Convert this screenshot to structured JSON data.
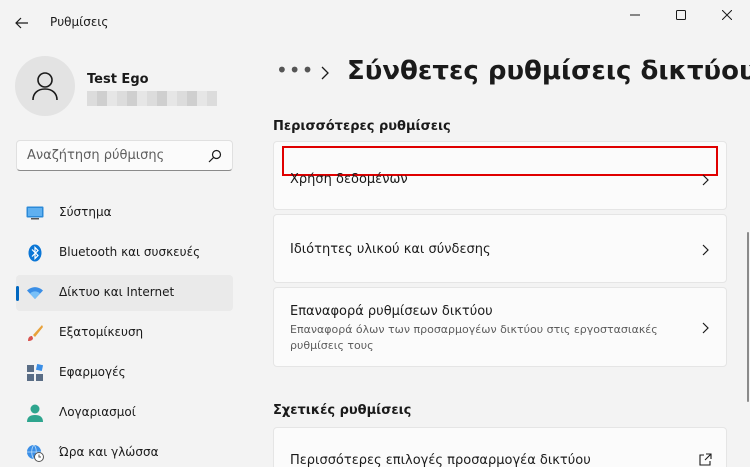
{
  "window": {
    "title": "Ρυθμίσεις"
  },
  "user": {
    "name": "Test Ego"
  },
  "search": {
    "placeholder": "Αναζήτηση ρύθμισης"
  },
  "sidebar": {
    "items": [
      {
        "label": "Σύστημα",
        "icon": "monitor-icon",
        "active": false
      },
      {
        "label": "Bluetooth και συσκευές",
        "icon": "bluetooth-icon",
        "active": false
      },
      {
        "label": "Δίκτυο και Internet",
        "icon": "wifi-icon",
        "active": true
      },
      {
        "label": "Εξατομίκευση",
        "icon": "brush-icon",
        "active": false
      },
      {
        "label": "Εφαρμογές",
        "icon": "apps-icon",
        "active": false
      },
      {
        "label": "Λογαριασμοί",
        "icon": "person-icon",
        "active": false
      },
      {
        "label": "Ώρα και γλώσσα",
        "icon": "globe-clock-icon",
        "active": false
      }
    ]
  },
  "breadcrumb": {
    "more": "•••",
    "title": "Σύνθετες ρυθμίσεις δικτύου"
  },
  "sections": [
    {
      "title": "Περισσότερες ρυθμίσεις",
      "cards": [
        {
          "label": "Χρήση δεδομένων",
          "description": "",
          "highlighted": true,
          "icon": "chevron-right-icon"
        },
        {
          "label": "Ιδιότητες υλικού και σύνδεσης",
          "description": "",
          "highlighted": false,
          "icon": "chevron-right-icon"
        },
        {
          "label": "Επαναφορά ρυθμίσεων δικτύου",
          "description": "Επαναφορά όλων των προσαρμογέων δικτύου στις εργοστασιακές ρυθμίσεις τους",
          "highlighted": false,
          "icon": "chevron-right-icon"
        }
      ]
    },
    {
      "title": "Σχετικές ρυθμίσεις",
      "cards": [
        {
          "label": "Περισσότερες επιλογές προσαρμογέα δικτύου",
          "description": "",
          "highlighted": false,
          "icon": "external-link-icon"
        }
      ]
    }
  ],
  "colors": {
    "accent": "#0067c0",
    "highlight_border": "#e00000",
    "background": "#f3f3f3"
  }
}
